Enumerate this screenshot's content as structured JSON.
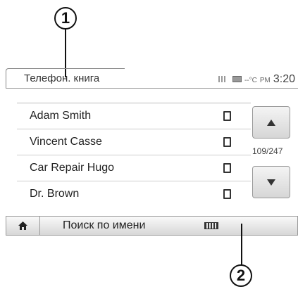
{
  "callouts": {
    "one": "1",
    "two": "2"
  },
  "header": {
    "title": "Телефон. книга",
    "status_extra": "--°C",
    "pm": "PM",
    "time": "3:20"
  },
  "contacts": [
    {
      "name": "Adam Smith"
    },
    {
      "name": "Vincent Casse"
    },
    {
      "name": "Car Repair Hugo"
    },
    {
      "name": "Dr. Brown"
    }
  ],
  "scroll": {
    "counter": "109/247"
  },
  "bottom_bar": {
    "search_label": "Поиск по имени"
  },
  "icons": [
    "home-icon",
    "keyboard-icon",
    "phone-icon",
    "arrow-up-icon",
    "arrow-down-icon",
    "signal-icon",
    "battery-icon"
  ]
}
